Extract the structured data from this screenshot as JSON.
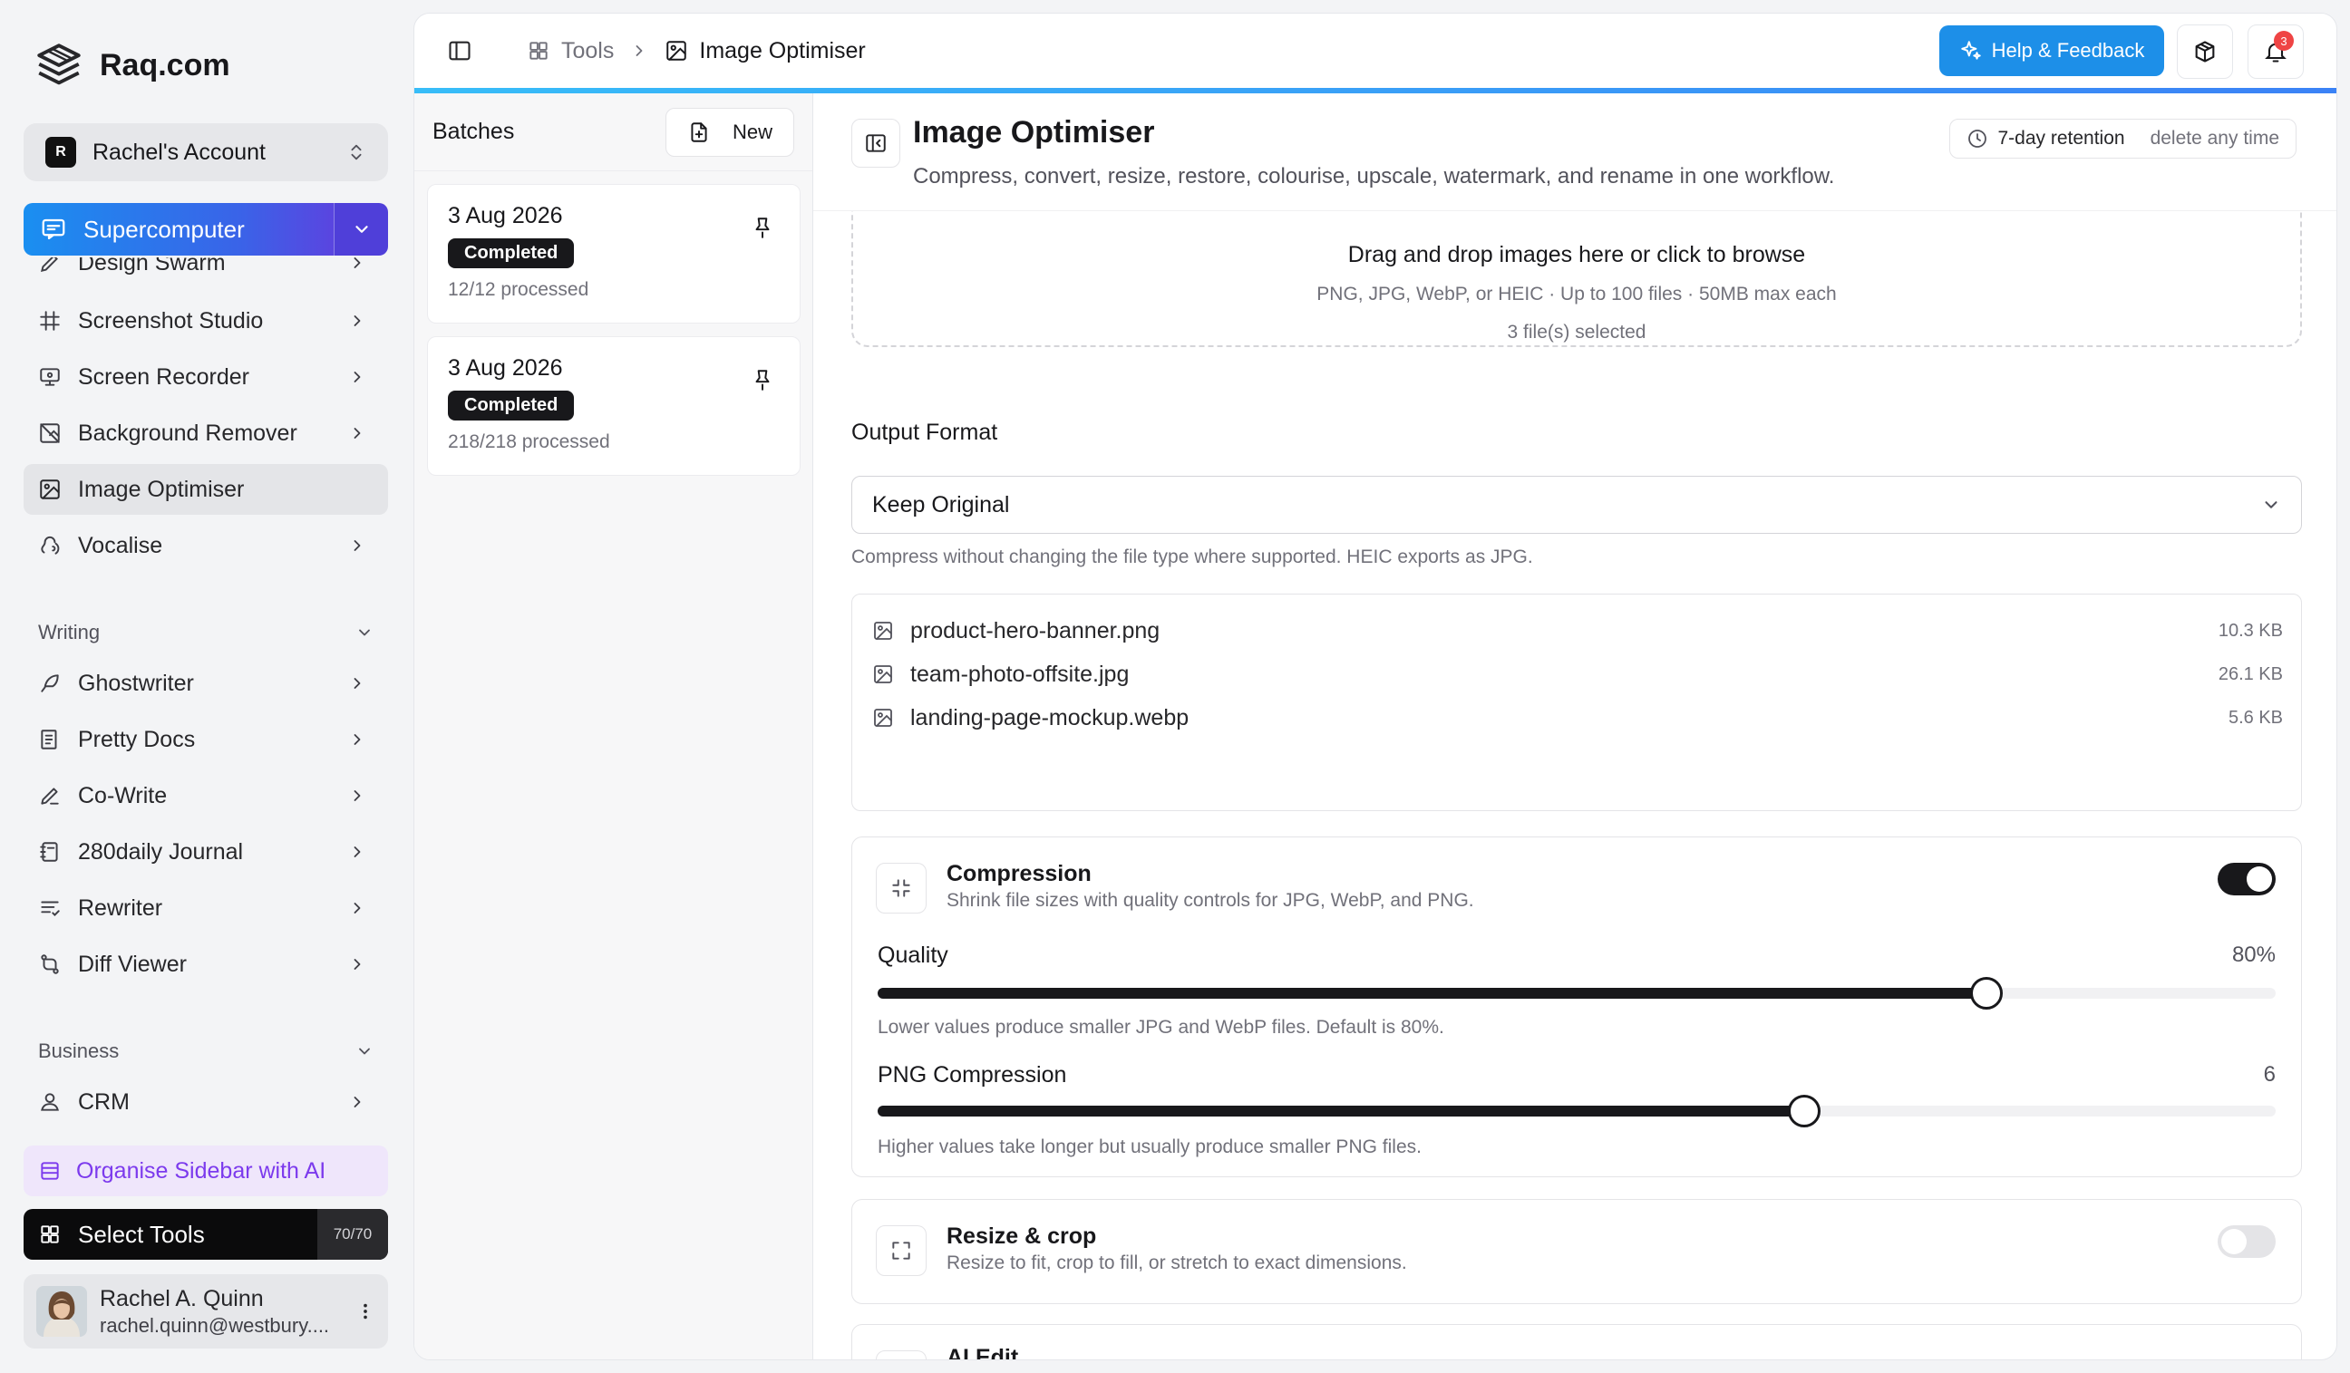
{
  "brand": {
    "name": "Raq.com"
  },
  "account": {
    "badge": "R",
    "name": "Rachel's Account"
  },
  "supercomputer": {
    "label": "Supercomputer"
  },
  "nav": {
    "items_top": [
      {
        "label": "Design Swarm",
        "icon": "design-icon"
      },
      {
        "label": "Screenshot Studio",
        "icon": "crop-icon"
      },
      {
        "label": "Screen Recorder",
        "icon": "screen-record-icon"
      },
      {
        "label": "Background Remover",
        "icon": "image-off-icon"
      },
      {
        "label": "Image Optimiser",
        "icon": "image-icon",
        "active": true
      },
      {
        "label": "Vocalise",
        "icon": "audio-icon"
      }
    ],
    "writing": {
      "title": "Writing",
      "items": [
        {
          "label": "Ghostwriter",
          "icon": "feather-icon"
        },
        {
          "label": "Pretty Docs",
          "icon": "docs-icon"
        },
        {
          "label": "Co-Write",
          "icon": "pen-icon"
        },
        {
          "label": "280daily Journal",
          "icon": "journal-icon"
        },
        {
          "label": "Rewriter",
          "icon": "rewrite-icon"
        },
        {
          "label": "Diff Viewer",
          "icon": "diff-icon"
        }
      ]
    },
    "business": {
      "title": "Business",
      "items": [
        {
          "label": "CRM",
          "icon": "contact-icon"
        }
      ]
    }
  },
  "organise": {
    "label": "Organise Sidebar with AI"
  },
  "select_tools": {
    "label": "Select Tools",
    "count": "70/70"
  },
  "user": {
    "name": "Rachel A. Quinn",
    "email": "rachel.quinn@westbury...."
  },
  "topbar": {
    "crumb_tools": "Tools",
    "crumb_current": "Image Optimiser",
    "help_label": "Help & Feedback",
    "notification_count": "3"
  },
  "batches": {
    "title": "Batches",
    "new_label": "New",
    "list": [
      {
        "date": "3 Aug 2026",
        "status": "Completed",
        "processed": "12/12 processed"
      },
      {
        "date": "3 Aug 2026",
        "status": "Completed",
        "processed": "218/218 processed"
      }
    ]
  },
  "page": {
    "title": "Image Optimiser",
    "subtitle": "Compress, convert, resize, restore, colourise, upscale, watermark, and rename in one workflow.",
    "retention": "7-day retention",
    "retention_sub": "delete any time"
  },
  "dropzone": {
    "title": "Drag and drop images here or click to browse",
    "sub": "PNG, JPG, WebP, or HEIC · Up to 100 files · 50MB max each",
    "count": "3 file(s) selected"
  },
  "output_format": {
    "label": "Output Format",
    "value": "Keep Original",
    "helper": "Compress without changing the file type where supported. HEIC exports as JPG."
  },
  "files": [
    {
      "name": "product-hero-banner.png",
      "size": "10.3 KB"
    },
    {
      "name": "team-photo-offsite.jpg",
      "size": "26.1 KB"
    },
    {
      "name": "landing-page-mockup.webp",
      "size": "5.6 KB"
    }
  ],
  "compression": {
    "title": "Compression",
    "sub": "Shrink file sizes with quality controls for JPG, WebP, and PNG.",
    "enabled": true,
    "quality": {
      "label": "Quality",
      "value_text": "80%",
      "fraction": 0.793,
      "help": "Lower values produce smaller JPG and WebP files. Default is 80%."
    },
    "png": {
      "label": "PNG Compression",
      "value_text": "6",
      "fraction": 0.663,
      "help": "Higher values take longer but usually produce smaller PNG files."
    }
  },
  "resize": {
    "title": "Resize & crop",
    "sub": "Resize to fit, crop to fill, or stretch to exact dimensions.",
    "enabled": false
  },
  "ai_edit": {
    "title": "AI Edit"
  },
  "colors": {
    "accent": "#1d8fe8",
    "dark": "#18181b",
    "purple": "#7c3aed"
  }
}
